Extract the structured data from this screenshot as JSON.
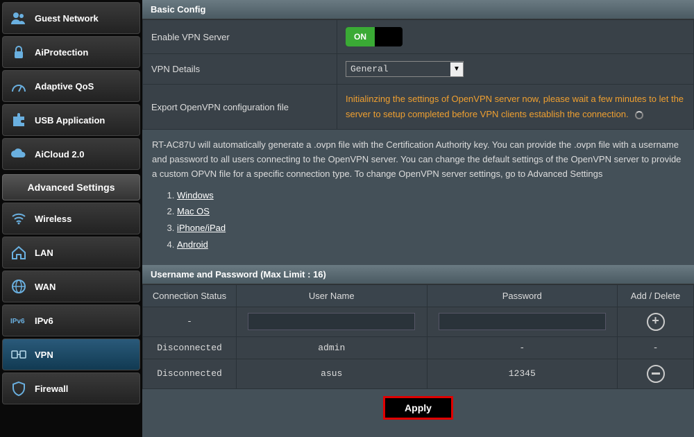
{
  "sidebar": {
    "items": [
      {
        "label": "Guest Network"
      },
      {
        "label": "AiProtection"
      },
      {
        "label": "Adaptive QoS"
      },
      {
        "label": "USB Application"
      },
      {
        "label": "AiCloud 2.0"
      }
    ],
    "section_title": "Advanced Settings",
    "adv_items": [
      {
        "label": "Wireless"
      },
      {
        "label": "LAN"
      },
      {
        "label": "WAN"
      },
      {
        "label": "IPv6"
      },
      {
        "label": "VPN"
      },
      {
        "label": "Firewall"
      }
    ]
  },
  "basic_config": {
    "title": "Basic Config",
    "enable_label": "Enable VPN Server",
    "toggle_on": "ON",
    "details_label": "VPN Details",
    "details_value": "General",
    "export_label": "Export OpenVPN configuration file",
    "init_text": "Initialinzing the settings of OpenVPN server now, please wait a few minutes to let the server to setup completed before VPN clients establish the connection."
  },
  "description": {
    "text": "RT-AC87U will automatically generate a .ovpn file with the Certification Authority key. You can provide the .ovpn file with a username and password to all users connecting to the OpenVPN server. You can change the default settings of the OpenVPN server to provide a custom OPVN file for a specific connection type. To change OpenVPN server settings, go to Advanced Settings",
    "links": [
      "Windows",
      "Mac OS",
      "iPhone/iPad",
      "Android"
    ]
  },
  "user_section": {
    "title": "Username and Password (Max Limit : 16)",
    "headers": {
      "status": "Connection Status",
      "user": "User Name",
      "pass": "Password",
      "action": "Add / Delete"
    },
    "input_row": {
      "status": "-"
    },
    "rows": [
      {
        "status": "Disconnected",
        "user": "admin",
        "pass": "-",
        "action": "-"
      },
      {
        "status": "Disconnected",
        "user": "asus",
        "pass": "12345",
        "action": "remove"
      }
    ]
  },
  "apply_label": "Apply"
}
